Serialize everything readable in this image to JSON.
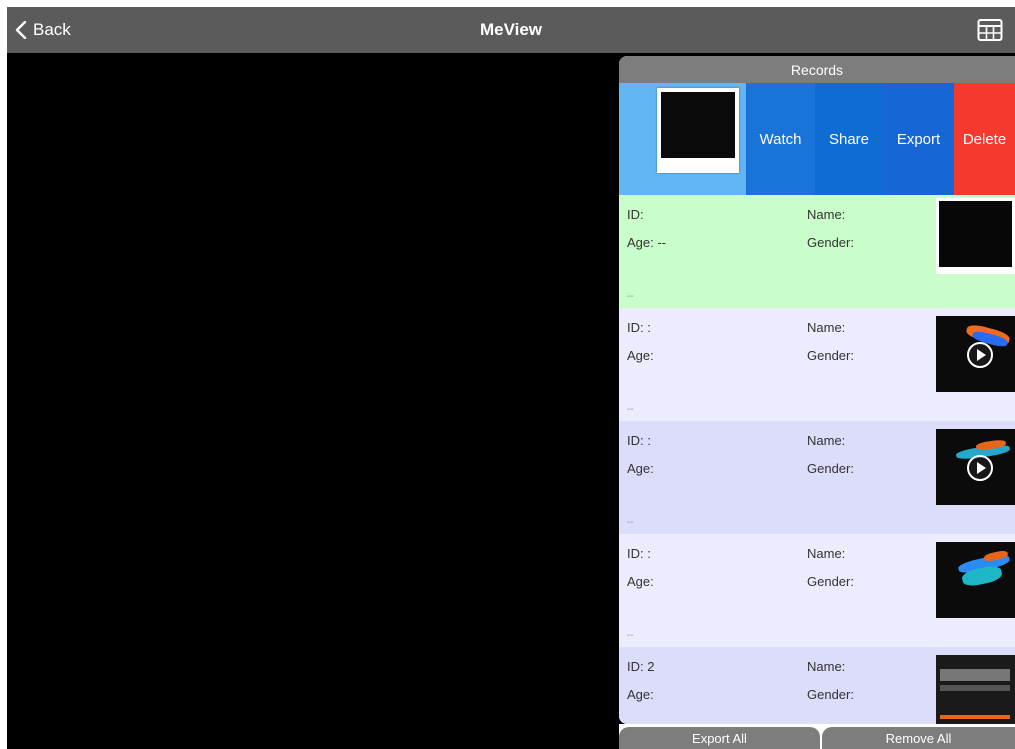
{
  "navbar": {
    "back_label": "Back",
    "title": "MeView",
    "grid_icon": "grid-icon",
    "bg_color": "#5b5b5b"
  },
  "panel": {
    "title": "Records",
    "swipe_actions": [
      "Watch",
      "Share",
      "Export",
      "Delete"
    ],
    "records": [
      {
        "id": "ID:",
        "name": "Name:",
        "age": "Age: --",
        "gender": "Gender:",
        "dash": "--",
        "bg": "#c9fdc9",
        "thumb": "white",
        "video": false
      },
      {
        "id": "ID: :",
        "name": "Name:",
        "age": "Age:",
        "gender": "Gender:",
        "dash": "--",
        "bg": "#ececff",
        "thumb": "doppler",
        "video": true
      },
      {
        "id": "ID: :",
        "name": "Name:",
        "age": "Age:",
        "gender": "Gender:",
        "dash": "--",
        "bg": "#dcdcfb",
        "thumb": "doppler",
        "video": true
      },
      {
        "id": "ID: :",
        "name": "Name:",
        "age": "Age:",
        "gender": "Gender:",
        "dash": "--",
        "bg": "#ececff",
        "thumb": "doppler",
        "video": false
      },
      {
        "id": "ID: 2",
        "name": "Name:",
        "age": "Age:",
        "gender": "Gender:",
        "dash": "",
        "bg": "#dcdcfb",
        "thumb": "bmode",
        "video": false
      }
    ]
  },
  "bottom": {
    "export_all": "Export All",
    "remove_all": "Remove All"
  },
  "colors": {
    "watch": "#1a73d9",
    "share": "#0f6cd4",
    "export": "#1766d6",
    "delete": "#f43a2f",
    "swipe_thumb_bg": "#62b6f3"
  }
}
